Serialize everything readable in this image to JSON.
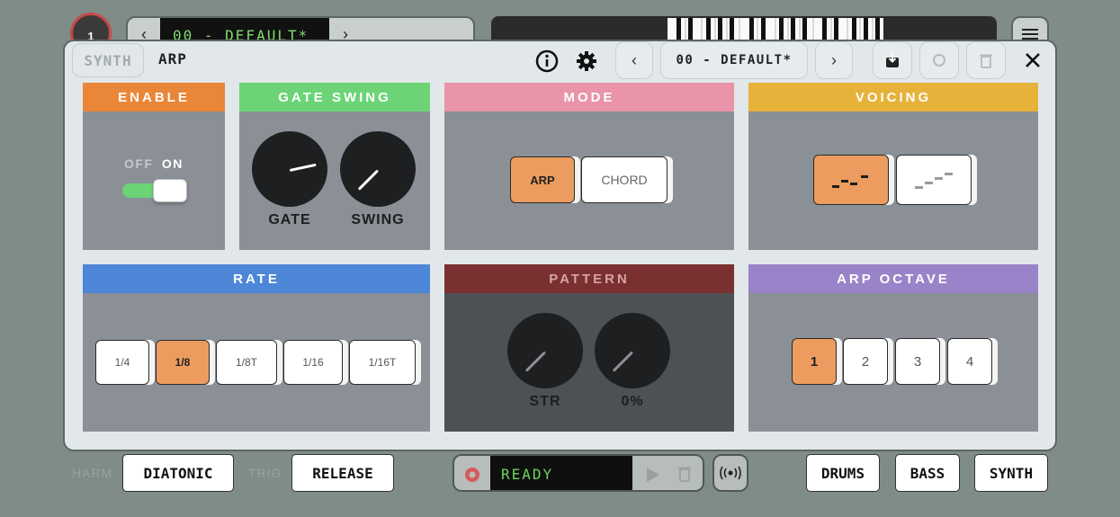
{
  "background": {
    "knob_value": "1",
    "preset_lcd": "00 - DEFAULT*"
  },
  "header": {
    "tab_synth": "SYNTH",
    "tab_arp": "ARP",
    "preset_name": "00 - DEFAULT*"
  },
  "panels": {
    "enable": {
      "title": "ENABLE",
      "off_label": "OFF",
      "on_label": "ON",
      "state": "on",
      "color": "#e98638"
    },
    "gate_swing": {
      "title": "GATE SWING",
      "knob1": "GATE",
      "knob2": "SWING",
      "color": "#6cd476"
    },
    "mode": {
      "title": "MODE",
      "options": [
        "ARP",
        "CHORD"
      ],
      "selected": "ARP",
      "color": "#e994a9"
    },
    "voicing": {
      "title": "VOICING",
      "color": "#e6b23a"
    },
    "rate": {
      "title": "RATE",
      "options": [
        "1/4",
        "1/8",
        "1/8T",
        "1/16",
        "1/16T"
      ],
      "selected": "1/8",
      "color": "#4e86d8"
    },
    "pattern": {
      "title": "PATTERN",
      "knob1": "STR",
      "knob2": "0%",
      "color": "#7a2f30"
    },
    "arp_octave": {
      "title": "ARP OCTAVE",
      "options": [
        "1",
        "2",
        "3",
        "4"
      ],
      "selected": "1",
      "color": "#9a83c8"
    }
  },
  "bottom": {
    "harm_label": "HARM",
    "harm_value": "DIATONIC",
    "trig_label": "TRIG",
    "trig_value": "RELEASE",
    "status": "READY",
    "engines": [
      "DRUMS",
      "BASS",
      "SYNTH"
    ]
  },
  "colors": {
    "accent": "#ec9c5e",
    "toggle_on": "#6cd476"
  }
}
